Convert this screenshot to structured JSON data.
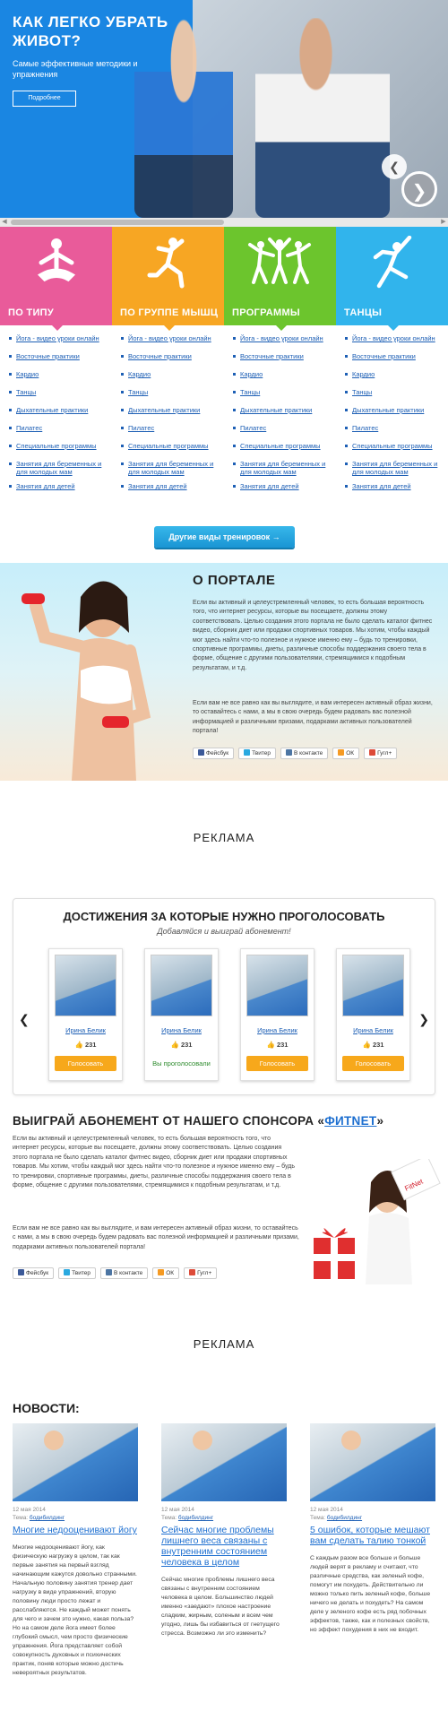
{
  "hero": {
    "title": "КАК ЛЕГКО УБРАТЬ ЖИВОТ?",
    "subtitle": "Самые эффективные методики и упражнения",
    "button": "Подробнее",
    "prev_icon": "chevron-left-icon",
    "next_icon": "chevron-right-icon"
  },
  "categories": [
    {
      "label": "ПО ТИПУ",
      "color": "#e95b9a",
      "icon": "yoga-pose-icon"
    },
    {
      "label": "ПО ГРУППЕ МЫШЦ",
      "color": "#f7a623",
      "icon": "lunge-pose-icon"
    },
    {
      "label": "ПРОГРАММЫ",
      "color": "#6cc52d",
      "icon": "group-dance-icon"
    },
    {
      "label": "ТАНЦЫ",
      "color": "#31b4ec",
      "icon": "dancer-icon"
    }
  ],
  "links": [
    "Йога - видео уроки онлайн",
    "Восточные практики",
    "Кардио",
    "Танцы",
    "Дыхательные практики",
    "Пилатес",
    "Специальные программы",
    "Занятия для беременных и для молодых мам",
    "Занятия для детей"
  ],
  "other_button": "Другие виды тренировок →",
  "about": {
    "title": "О ПОРТАЛЕ",
    "p1": "Если вы активный и целеустремленный человек, то есть большая вероятность того, что интернет ресурсы, которые вы посещаете, должны этому соответствовать. Целью создания этого портала не было сделать каталог фитнес видео, сборник диет или продажи спортивных товаров. Мы хотим, чтобы каждый мог здесь найти что-то полезное и нужное именно ему – будь то тренировки, спортивные программы, диеты, различные способы поддержания своего тела в форме, общение с другими пользователями, стремящимися к подобным результатам, и т.д.",
    "p2": "Если вам не все равно как вы выглядите, и вам интересен активный образ жизни, то оставайтесь с нами, а мы в свою очередь будем радовать вас полезной информацией и различными призами, подарками активных пользователей портала!"
  },
  "social": [
    {
      "label": "Фейсбук",
      "color": "#3b5998"
    },
    {
      "label": "Твитер",
      "color": "#2aa9e0"
    },
    {
      "label": "В контакте",
      "color": "#4c75a3"
    },
    {
      "label": "ОК",
      "color": "#f59a23"
    },
    {
      "label": "Гугл+",
      "color": "#dd4b39"
    }
  ],
  "ads": {
    "label1": "РЕКЛАМА",
    "label2": "РЕКЛАМА"
  },
  "achievements": {
    "title": "ДОСТИЖЕНИЯ ЗА КОТОРЫЕ НУЖНО ПРОГОЛОСОВАТЬ",
    "subtitle": "Добавляйся и выиграй абонемент!",
    "cards": [
      {
        "name": "Ирина Белик",
        "likes": "231",
        "action": "Голосовать",
        "voted": false
      },
      {
        "name": "Ирина Белик",
        "likes": "231",
        "action": "Вы проголосовали",
        "voted": true
      },
      {
        "name": "Ирина Белик",
        "likes": "231",
        "action": "Голосовать",
        "voted": false
      },
      {
        "name": "Ирина Белик",
        "likes": "231",
        "action": "Голосовать",
        "voted": false
      }
    ]
  },
  "sponsor": {
    "title_prefix": "ВЫИГРАЙ АБОНЕМЕНТ ОТ НАШЕГО СПОНСОРА «",
    "brand": "ФИТNET",
    "title_suffix": "»",
    "p1": "Если вы активный и целеустремленный человек, то есть большая вероятность того, что интернет ресурсы, которые вы посещаете, должны этому соответствовать. Целью создания этого портала не было сделать каталог фитнес видео, сборник диет или продажи спортивных товаров. Мы хотим, чтобы каждый мог здесь найти что-то полезное и нужное именно ему – будь то тренировки, спортивные программы, диеты, различные способы поддержания своего тела в форме, общение с другими пользователями, стремящимися к подобным результатам, и т.д.",
    "p2": "Если вам не все равно как вы выглядите, и вам интересен активный образ жизни, то оставайтесь с нами, а мы в свою очередь будем радовать вас полезной информацией и различными призами, подарками активных пользователей портала!"
  },
  "news": {
    "title": "НОВОСТИ:",
    "items": [
      {
        "date": "12 мая 2014",
        "tag_prefix": "Тема: ",
        "tag": "бодибилдинг",
        "headline": "Многие недооценивают йогу",
        "body": "Многие недооценивают йогу, как физическую нагрузку в целом, так как первые занятия на первый взгляд начинающим кажутся довольно странными. Начальную половину занятия тренер дает нагрузку в виде упражнений, вторую половину люди просто лежат и расслабляются. Не каждый может понять для чего и зачем это нужно, какая польза? Но на самом деле йога имеет более глубокий смысл, чем просто физические упражнения. Йога представляет собой совокупность духовных и психических практик, поняв которые можно достичь невероятных результатов."
      },
      {
        "date": "12 мая 2014",
        "tag_prefix": "Тема: ",
        "tag": "бодибилдинг",
        "headline": "Сейчас многие проблемы лишнего веса связаны с внутренним состоянием человека в целом",
        "body": "Сейчас многие проблемы лишнего веса связаны с внутренним состоянием человека в целом. Большинство людей именно «заедают» плохое настроение сладким, жирным, соленым и всем чем угодно, лишь бы избавиться от гнетущего стресса. Возможно ли это изменить?"
      },
      {
        "date": "12 мая 2014",
        "tag_prefix": "Тема: ",
        "tag": "бодибилдинг",
        "headline": "5 ошибок, которые мешают вам сделать талию тонкой",
        "body": "С каждым разом все больше и больше людей верят в рекламу и считают, что различные средства, как зеленый кофе, помогут им похудеть. Действительно ли можно только пить зеленый кофе, больше ничего не делать и похудеть? На самом деле у зеленого кофе есть ряд побочных эффектов, также, как и полезных свойств, но эффект похудения в них не входит."
      }
    ]
  }
}
